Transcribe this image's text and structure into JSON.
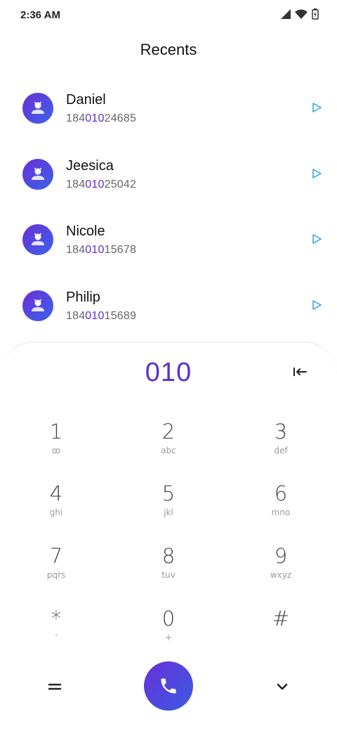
{
  "status": {
    "time": "2:36 AM"
  },
  "header": {
    "title": "Recents"
  },
  "recents": [
    {
      "name": "Daniel",
      "number_pre": "184",
      "number_match": "010",
      "number_post": "24685"
    },
    {
      "name": "Jeesica",
      "number_pre": "184",
      "number_match": "010",
      "number_post": "25042"
    },
    {
      "name": "Nicole",
      "number_pre": "184",
      "number_match": "010",
      "number_post": "15678"
    },
    {
      "name": "Philip",
      "number_pre": "184",
      "number_match": "010",
      "number_post": "15689"
    }
  ],
  "dialpad": {
    "input_value": "010",
    "keys": [
      {
        "digit": "1",
        "letters": "ꝏ"
      },
      {
        "digit": "2",
        "letters": "abc"
      },
      {
        "digit": "3",
        "letters": "def"
      },
      {
        "digit": "4",
        "letters": "ghi"
      },
      {
        "digit": "5",
        "letters": "jkl"
      },
      {
        "digit": "6",
        "letters": "mno"
      },
      {
        "digit": "7",
        "letters": "pqrs"
      },
      {
        "digit": "8",
        "letters": "tuv"
      },
      {
        "digit": "9",
        "letters": "wxyz"
      },
      {
        "digit": "*",
        "letters": "'"
      },
      {
        "digit": "0",
        "letters": "+"
      },
      {
        "digit": "#",
        "letters": ""
      }
    ]
  },
  "colors": {
    "accent": "#5a2fd0",
    "gradient_start": "#6a2fd8",
    "gradient_end": "#3b63e8",
    "arrow": "#2aa3e8"
  },
  "icons": {
    "status": [
      "signal-icon",
      "wifi-icon",
      "battery-icon"
    ],
    "row_action": "outgoing-call-arrow-icon",
    "backspace": "backspace-icon",
    "call": "phone-icon",
    "menu": "menu-icon",
    "collapse": "chevron-down-icon"
  }
}
